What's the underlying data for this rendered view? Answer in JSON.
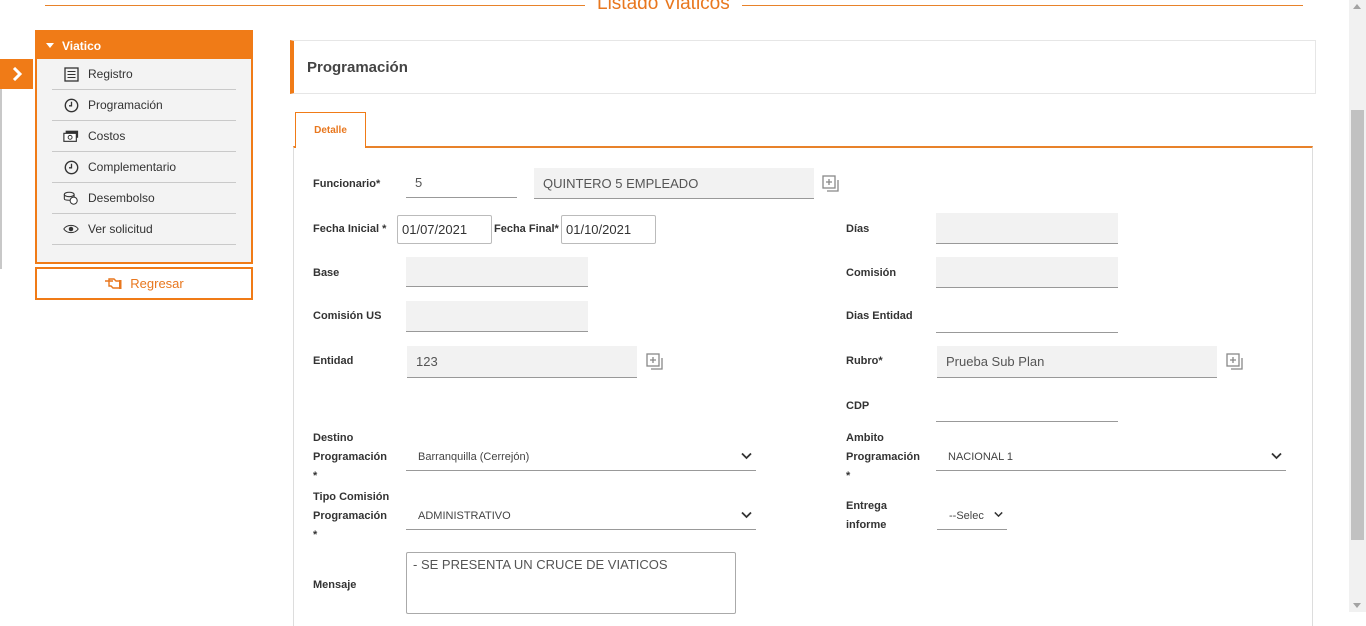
{
  "page": {
    "title": "Listado Viaticos"
  },
  "sidebar": {
    "header": "Viatico",
    "items": [
      {
        "label": "Registro",
        "icon": "list-icon"
      },
      {
        "label": "Programación",
        "icon": "clock-icon"
      },
      {
        "label": "Costos",
        "icon": "money-icon"
      },
      {
        "label": "Complementario",
        "icon": "clock-icon"
      },
      {
        "label": "Desembolso",
        "icon": "coins-icon"
      },
      {
        "label": "Ver solicitud",
        "icon": "eye-icon"
      }
    ],
    "back_label": "Regresar"
  },
  "section": {
    "title": "Programación",
    "tab": "Detalle"
  },
  "form": {
    "funcionario": {
      "label": "Funcionario*",
      "value": "5",
      "name": "QUINTERO 5 EMPLEADO"
    },
    "fecha_inicial": {
      "label": "Fecha Inicial *",
      "value": "01/07/2021"
    },
    "fecha_final": {
      "label": "Fecha Final*",
      "value": "01/10/2021"
    },
    "dias": {
      "label": "Días",
      "value": ""
    },
    "base": {
      "label": "Base",
      "value": ""
    },
    "comision": {
      "label": "Comisión",
      "value": ""
    },
    "comision_us": {
      "label": "Comisión US",
      "value": ""
    },
    "dias_entidad": {
      "label": "Dias Entidad",
      "value": ""
    },
    "entidad": {
      "label": "Entidad",
      "value": "123"
    },
    "rubro": {
      "label": "Rubro*",
      "value": "Prueba Sub Plan"
    },
    "cdp": {
      "label": "CDP",
      "value": ""
    },
    "destino": {
      "label_1": "Destino",
      "label_2": "Programación",
      "label_3": "*",
      "value": "Barranquilla (Cerrejón)"
    },
    "ambito": {
      "label_1": "Ambito",
      "label_2": "Programación",
      "label_3": "*",
      "value": "NACIONAL 1"
    },
    "tipo_comision": {
      "label_1": "Tipo Comisión",
      "label_2": "Programación",
      "label_3": "*",
      "value": "ADMINISTRATIVO"
    },
    "entrega_informe": {
      "label_1": "Entrega",
      "label_2": "informe",
      "value": "--Selec"
    },
    "mensaje": {
      "label": "Mensaje",
      "value": "- SE PRESENTA UN CRUCE DE VIATICOS"
    }
  },
  "colors": {
    "accent": "#f07b17",
    "accent_text": "#e8771e"
  }
}
